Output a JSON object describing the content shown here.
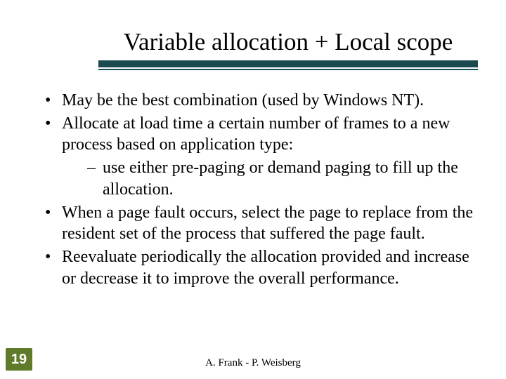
{
  "slide": {
    "title": "Variable allocation + Local scope",
    "page_number": "19",
    "footer": "A. Frank - P. Weisberg",
    "bullets": [
      {
        "text": "May be the best combination (used by Windows NT)."
      },
      {
        "text": "Allocate at load time a certain number of frames to a new process based on application type:",
        "sub": [
          "use either pre-paging or demand paging to fill up the allocation."
        ]
      },
      {
        "text": "When a page fault occurs, select the page to replace from the resident set of the process that suffered the page fault."
      },
      {
        "text": "Reevaluate periodically the allocation provided and increase or decrease it to improve the overall performance."
      }
    ]
  }
}
